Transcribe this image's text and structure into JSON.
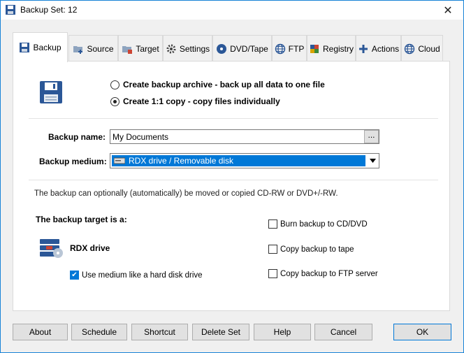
{
  "window": {
    "title": "Backup Set: 12",
    "close_glyph": "✕"
  },
  "tabs": [
    {
      "label": "Backup",
      "icon": "floppy-icon"
    },
    {
      "label": "Source",
      "icon": "folder-add-icon"
    },
    {
      "label": "Target",
      "icon": "folder-target-icon"
    },
    {
      "label": "Settings",
      "icon": "gear-icon"
    },
    {
      "label": "DVD/Tape",
      "icon": "disc-icon"
    },
    {
      "label": "FTP",
      "icon": "globe-icon"
    },
    {
      "label": "Registry",
      "icon": "registry-icon"
    },
    {
      "label": "Actions",
      "icon": "plus-icon"
    },
    {
      "label": "Cloud",
      "icon": "globe-icon"
    }
  ],
  "mode": {
    "option_archive": "Create backup archive - back up all data to one file",
    "option_copy": "Create 1:1 copy - copy files individually",
    "selected": "copy"
  },
  "form": {
    "name_label": "Backup name:",
    "name_value": "My Documents",
    "browse_label": "...",
    "medium_label": "Backup medium:",
    "medium_value": "RDX drive / Removable disk"
  },
  "info_text": "The backup can optionally (automatically) be moved or copied CD-RW or DVD+/-RW.",
  "target": {
    "heading": "The backup target is a:",
    "device": "RDX drive",
    "use_as_hdd_label": "Use medium like a hard disk drive",
    "use_as_hdd_checked": true
  },
  "options": {
    "burn_label": "Burn backup to CD/DVD",
    "burn_checked": false,
    "tape_label": "Copy backup to tape",
    "tape_checked": false,
    "ftp_label": "Copy backup to FTP server",
    "ftp_checked": false
  },
  "buttons": {
    "about": "About",
    "schedule": "Schedule",
    "shortcut": "Shortcut",
    "delete_set": "Delete Set",
    "help": "Help",
    "cancel": "Cancel",
    "ok": "OK"
  },
  "colors": {
    "accent": "#0078d7",
    "window_border": "#1883d7"
  }
}
